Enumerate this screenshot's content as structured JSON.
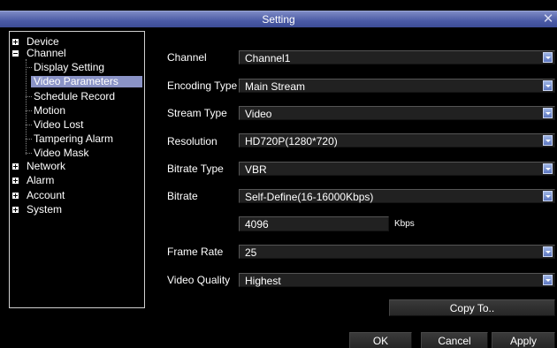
{
  "window": {
    "title": "Setting",
    "close_icon": "close-icon"
  },
  "tree": [
    {
      "label": "Device",
      "level": 0,
      "icon": "expand-plus-icon",
      "selected": false
    },
    {
      "label": "Channel",
      "level": 0,
      "icon": "collapse-minus-icon",
      "selected": false
    },
    {
      "label": "Display Setting",
      "level": 1,
      "selected": false
    },
    {
      "label": "Video Parameters",
      "level": 1,
      "selected": true
    },
    {
      "label": "Schedule Record",
      "level": 1,
      "selected": false
    },
    {
      "label": "Motion",
      "level": 1,
      "selected": false
    },
    {
      "label": "Video Lost",
      "level": 1,
      "selected": false
    },
    {
      "label": "Tampering Alarm",
      "level": 1,
      "selected": false
    },
    {
      "label": "Video Mask",
      "level": 1,
      "selected": false
    },
    {
      "label": "Network",
      "level": 0,
      "icon": "expand-plus-icon",
      "selected": false
    },
    {
      "label": "Alarm",
      "level": 0,
      "icon": "expand-plus-icon",
      "selected": false
    },
    {
      "label": "Account",
      "level": 0,
      "icon": "expand-plus-icon",
      "selected": false
    },
    {
      "label": "System",
      "level": 0,
      "icon": "expand-plus-icon",
      "selected": false
    }
  ],
  "form": {
    "channel": {
      "label": "Channel",
      "value": "Channel1"
    },
    "encoding_type": {
      "label": "Encoding Type",
      "value": "Main Stream"
    },
    "stream_type": {
      "label": "Stream Type",
      "value": "Video"
    },
    "resolution": {
      "label": "Resolution",
      "value": "HD720P(1280*720)"
    },
    "bitrate_type": {
      "label": "Bitrate Type",
      "value": "VBR"
    },
    "bitrate": {
      "label": "Bitrate",
      "value": "Self-Define(16-16000Kbps)",
      "custom_value": "4096",
      "unit": "Kbps"
    },
    "frame_rate": {
      "label": "Frame Rate",
      "value": "25"
    },
    "video_quality": {
      "label": "Video Quality",
      "value": "Highest"
    }
  },
  "buttons": {
    "copy_to": "Copy To..",
    "ok": "OK",
    "cancel": "Cancel",
    "apply": "Apply"
  },
  "colors": {
    "title_bar": "#4a5aa5",
    "selection": "#8a93c6",
    "background": "#000000"
  }
}
